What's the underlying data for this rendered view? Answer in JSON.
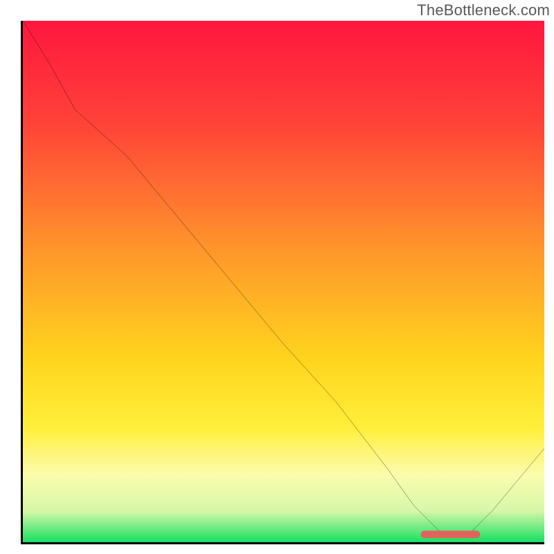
{
  "watermark": {
    "text": "TheBottleneck.com"
  },
  "chart_data": {
    "type": "line",
    "title": "",
    "xlabel": "",
    "ylabel": "",
    "xlim": [
      0,
      100
    ],
    "ylim": [
      0,
      100
    ],
    "grid": false,
    "legend": false,
    "gradient_stops": [
      {
        "offset": 0,
        "color": "#ff163f"
      },
      {
        "offset": 20,
        "color": "#ff4338"
      },
      {
        "offset": 45,
        "color": "#ff9a2a"
      },
      {
        "offset": 65,
        "color": "#ffd41e"
      },
      {
        "offset": 78,
        "color": "#ffef3a"
      },
      {
        "offset": 87,
        "color": "#fbfcad"
      },
      {
        "offset": 94,
        "color": "#d7f7a8"
      },
      {
        "offset": 100,
        "color": "#17e062"
      }
    ],
    "series": [
      {
        "name": "bottleneck-curve",
        "x": [
          0,
          5,
          10,
          20,
          30,
          40,
          50,
          60,
          70,
          75,
          81,
          85,
          90,
          95,
          100
        ],
        "values": [
          100,
          92,
          83,
          74,
          62,
          50,
          38,
          27,
          14,
          7,
          1,
          1,
          6,
          12,
          18
        ]
      }
    ],
    "optimal_marker": {
      "x_start": 77,
      "x_end": 87,
      "y": 1.5,
      "color": "#e0635e"
    }
  }
}
